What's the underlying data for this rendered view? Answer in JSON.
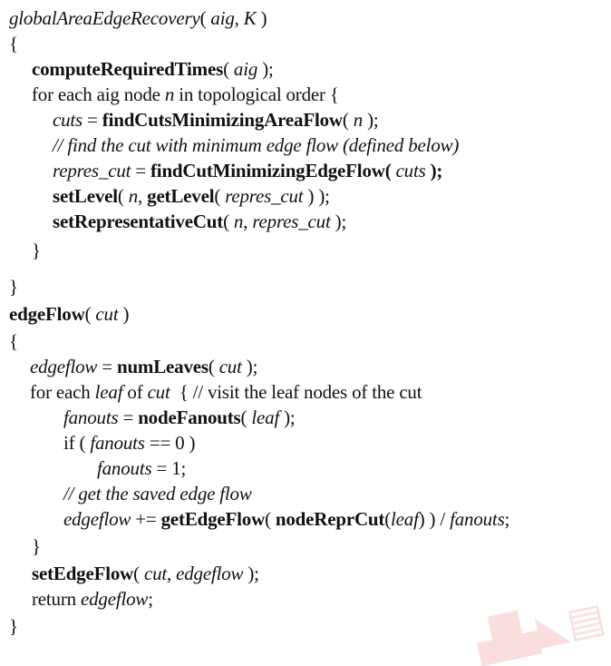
{
  "lines": [
    [
      {
        "t": "globalAreaEdgeRecovery",
        "s": "i"
      },
      {
        "t": "( "
      },
      {
        "t": "aig",
        "s": "i"
      },
      {
        "t": ", "
      },
      {
        "t": "K",
        "s": "i"
      },
      {
        "t": " )"
      }
    ],
    [
      {
        "t": "{"
      }
    ],
    [
      {
        "t": "computeRequiredTimes",
        "s": "b"
      },
      {
        "t": "( "
      },
      {
        "t": "aig",
        "s": "i"
      },
      {
        "t": " );"
      }
    ],
    [
      {
        "t": "for each aig node "
      },
      {
        "t": "n",
        "s": "i"
      },
      {
        "t": " in topological order {"
      }
    ],
    [
      {
        "t": "cuts",
        "s": "i"
      },
      {
        "t": " = "
      },
      {
        "t": "findCutsMinimizingAreaFlow",
        "s": "b"
      },
      {
        "t": "( "
      },
      {
        "t": "n",
        "s": "i"
      },
      {
        "t": " );"
      }
    ],
    [
      {
        "t": "// find the cut with minimum edge flow (defined below)",
        "s": "i"
      }
    ],
    [
      {
        "t": "repres_cut",
        "s": "i"
      },
      {
        "t": " = "
      },
      {
        "t": "findCutMinimizingEdgeFlow(",
        "s": "b"
      },
      {
        "t": " "
      },
      {
        "t": "cuts",
        "s": "i"
      },
      {
        "t": " );",
        "s": "b"
      }
    ],
    [
      {
        "t": "setLevel",
        "s": "b"
      },
      {
        "t": "( "
      },
      {
        "t": "n",
        "s": "i"
      },
      {
        "t": ", "
      },
      {
        "t": "getLevel",
        "s": "b"
      },
      {
        "t": "( "
      },
      {
        "t": "repres_cut",
        "s": "i"
      },
      {
        "t": " ) );"
      }
    ],
    [
      {
        "t": "setRepresentativeCut",
        "s": "b"
      },
      {
        "t": "( "
      },
      {
        "t": "n",
        "s": "i"
      },
      {
        "t": ", "
      },
      {
        "t": "repres_cut",
        "s": "i"
      },
      {
        "t": " );"
      }
    ],
    [
      {
        "t": "}"
      }
    ],
    [
      {
        "t": "}"
      }
    ],
    [
      {
        "t": "edgeFlow",
        "s": "b"
      },
      {
        "t": "( "
      },
      {
        "t": "cut",
        "s": "i"
      },
      {
        "t": " )"
      }
    ],
    [
      {
        "t": "{"
      }
    ],
    [
      {
        "t": "edgeflow",
        "s": "i"
      },
      {
        "t": " = "
      },
      {
        "t": "numLeaves",
        "s": "b"
      },
      {
        "t": "( "
      },
      {
        "t": "cut",
        "s": "i"
      },
      {
        "t": " );"
      }
    ],
    [
      {
        "t": "for each "
      },
      {
        "t": "leaf",
        "s": "i"
      },
      {
        "t": " of "
      },
      {
        "t": "cut",
        "s": "i"
      },
      {
        "t": "  { // visit the leaf nodes of the cut"
      }
    ],
    [
      {
        "t": "fanouts",
        "s": "i"
      },
      {
        "t": " = "
      },
      {
        "t": "nodeFanouts",
        "s": "b"
      },
      {
        "t": "( "
      },
      {
        "t": "leaf",
        "s": "i"
      },
      {
        "t": " );"
      }
    ],
    [
      {
        "t": "if ( "
      },
      {
        "t": "fanouts",
        "s": "i"
      },
      {
        "t": " == 0 )"
      }
    ],
    [
      {
        "t": "fanouts",
        "s": "i"
      },
      {
        "t": " = 1;"
      }
    ],
    [
      {
        "t": "// get the saved edge flow",
        "s": "i"
      }
    ],
    [
      {
        "t": "edgeflow",
        "s": "i"
      },
      {
        "t": " += "
      },
      {
        "t": "getEdgeFlow",
        "s": "b"
      },
      {
        "t": "( "
      },
      {
        "t": "nodeReprCut",
        "s": "b"
      },
      {
        "t": "("
      },
      {
        "t": "leaf",
        "s": "i"
      },
      {
        "t": ") ) / "
      },
      {
        "t": "fanouts",
        "s": "i"
      },
      {
        "t": ";"
      }
    ],
    [
      {
        "t": "}"
      }
    ],
    [
      {
        "t": "setEdgeFlow",
        "s": "b"
      },
      {
        "t": "( "
      },
      {
        "t": "cut, edgeflow",
        "s": "i"
      },
      {
        "t": " );"
      }
    ],
    [
      {
        "t": "return "
      },
      {
        "t": "edgeflow",
        "s": "i"
      },
      {
        "t": ";"
      }
    ],
    [
      {
        "t": "}"
      }
    ]
  ]
}
